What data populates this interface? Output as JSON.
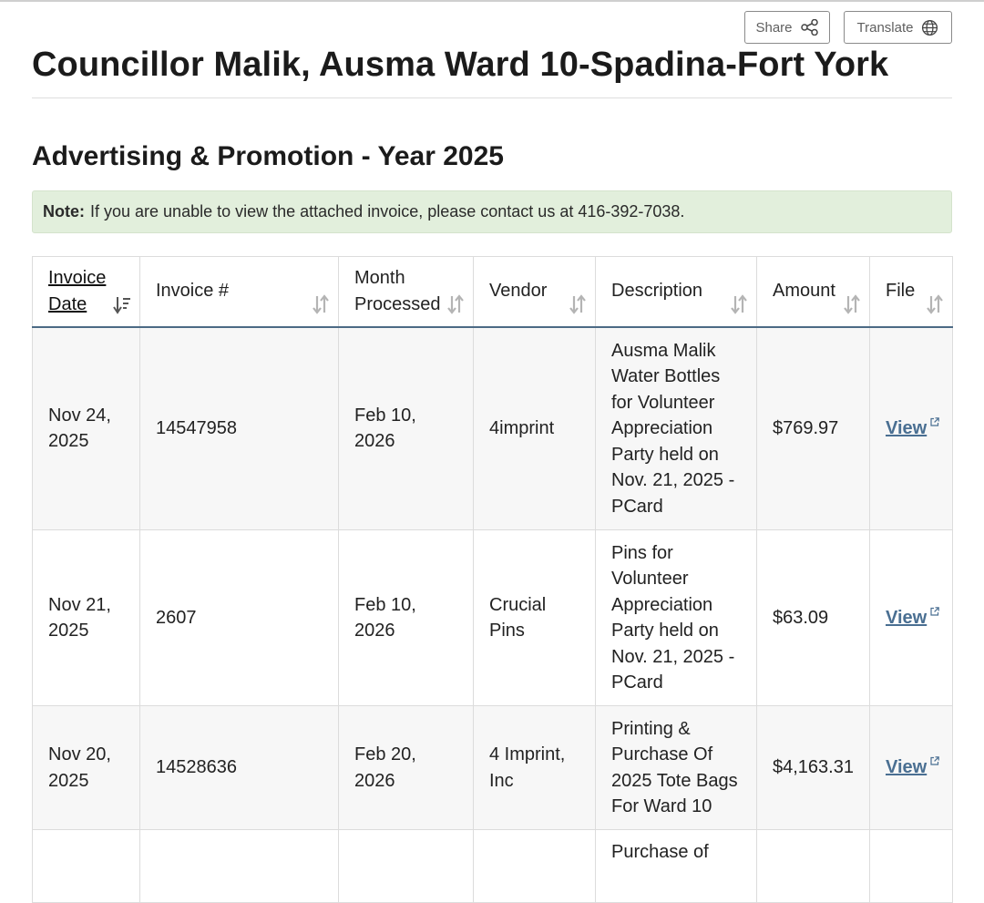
{
  "toolbar": {
    "share_label": "Share",
    "translate_label": "Translate"
  },
  "page": {
    "title": "Councillor Malik, Ausma Ward 10-Spadina-Fort York",
    "section_title": "Advertising & Promotion - Year 2025"
  },
  "note": {
    "label": "Note:",
    "text": "If you are unable to view the attached invoice, please contact us at 416-392-7038."
  },
  "table": {
    "columns": [
      {
        "label": "Invoice Date",
        "sorted": true
      },
      {
        "label": "Invoice #"
      },
      {
        "label": "Month Processed"
      },
      {
        "label": "Vendor"
      },
      {
        "label": "Description"
      },
      {
        "label": "Amount"
      },
      {
        "label": "File"
      }
    ],
    "rows": [
      {
        "invoice_date": "Nov 24, 2025",
        "invoice_number": "14547958",
        "month_processed": "Feb 10, 2026",
        "vendor": "4imprint",
        "description": "Ausma Malik Water Bottles for Volunteer Appreciation Party held on Nov. 21, 2025 - PCard",
        "amount": "$769.97",
        "file": "View"
      },
      {
        "invoice_date": "Nov 21, 2025",
        "invoice_number": "2607",
        "month_processed": "Feb 10, 2026",
        "vendor": "Crucial Pins",
        "description": "Pins for Volunteer Appreciation Party held on Nov. 21, 2025 - PCard",
        "amount": "$63.09",
        "file": "View"
      },
      {
        "invoice_date": "Nov 20, 2025",
        "invoice_number": "14528636",
        "month_processed": "Feb 20, 2026",
        "vendor": "4 Imprint, Inc",
        "description": "Printing & Purchase Of 2025 Tote Bags For Ward 10",
        "amount": "$4,163.31",
        "file": "View"
      },
      {
        "invoice_date": "",
        "invoice_number": "",
        "month_processed": "",
        "vendor": "",
        "description": "Purchase of",
        "amount": "",
        "file": ""
      }
    ]
  },
  "colors": {
    "note_bg": "#e2efdc",
    "link": "#4a6f92",
    "header_rule": "#4c6a85"
  },
  "icons": {
    "share": "share-icon",
    "translate": "globe-icon",
    "sort": "sort-arrows-icon",
    "sort_active": "sort-descending-icon",
    "external": "external-link-icon"
  }
}
